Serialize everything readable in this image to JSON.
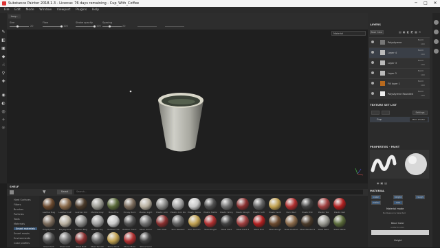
{
  "window": {
    "title": "Substance Painter 2018.1.3 - License: 76 days remaining - Cup_With_Coffee",
    "minimize": "─",
    "maximize": "□",
    "close": "✕"
  },
  "menu": [
    "File",
    "Edit",
    "Mode",
    "Window",
    "Viewport",
    "Plugins",
    "Help"
  ],
  "tool_options": {
    "preset_button": "Lazy...",
    "sliders": [
      {
        "label": "Size",
        "value": "20"
      },
      {
        "label": "Flow",
        "value": "100"
      },
      {
        "label": "Stroke opacity",
        "value": "100"
      },
      {
        "label": "Spacing",
        "value": "20"
      }
    ]
  },
  "viewport": {
    "mode": "Material"
  },
  "layers": {
    "title": "LAYERS",
    "channel": "Base Color",
    "items": [
      {
        "name": "Polystyrene",
        "blend": "Norm",
        "opacity": "100"
      },
      {
        "name": "Layer 4",
        "blend": "Norm",
        "opacity": "100"
      },
      {
        "name": "Layer 3",
        "blend": "Norm",
        "opacity": "100"
      },
      {
        "name": "Layer 2",
        "blend": "Norm",
        "opacity": "100"
      },
      {
        "name": "Fill layer 1",
        "blend": "Norm",
        "opacity": "100"
      },
      {
        "name": "Polystyrene Rounded",
        "blend": "Norm",
        "opacity": "100"
      }
    ]
  },
  "texture_set_list": {
    "title": "TEXTURE SET LIST",
    "settings_button": "Settings",
    "item": "Cup",
    "shader": "Main shader"
  },
  "properties": {
    "title": "PROPERTIES - PAINT",
    "material_title": "MATERIAL",
    "channels": [
      "color",
      "height",
      "rough",
      "metal",
      "nrm"
    ],
    "material_mode": "Material mode",
    "no_resource": "No Resource Selected",
    "base_color": "Base Color",
    "uniform": "uniform color",
    "height": "Height"
  },
  "shelf": {
    "title": "SHELF",
    "filter": "Smart",
    "search_placeholder": "Search...",
    "categories": [
      "Hard Surfaces",
      "Filters",
      "Brushes",
      "Particles",
      "Tools",
      "Materials",
      "Smart materials",
      "Smart masks",
      "Environments",
      "Color profiles"
    ],
    "row1": [
      "Leather Bag",
      "Leather Calf",
      "Leather Old",
      "Marble Gray",
      "Moss Fine",
      "Honey Rock",
      "Plaster Light",
      "Plastic Arm",
      "Plastic Arm Rough",
      "Plastic Gloss",
      "Plastic Matte",
      "Plastic Shiny",
      "Plastic Rough",
      "Plastic Soft",
      "Plastic Gold",
      "Paint Red",
      "Plastic Ext",
      "Plastic Tex",
      "Plastic Red"
    ],
    "row2": [
      "Polystyrene",
      "Polystyrene",
      "Protein Bag",
      "Rubber Dry",
      "Rubber Tire",
      "Rubber Tire 2",
      "Silver Armor",
      "Skin Pale",
      "Skin Peasant",
      "Skin Human",
      "Steel Bright",
      "Steel Dark",
      "Steel Dark 2",
      "Steel Dull",
      "Steel Rough",
      "Steel Painted",
      "Steel Painted 2",
      "Steel Paint",
      "Steel Matte"
    ],
    "row3": [
      "Steel Dark",
      "Steel Gold",
      "Steel Rust",
      "Steel Tarnish",
      "Stone Rock",
      "Stone Moss",
      "Stone Sand"
    ]
  },
  "colors": {
    "accent": "#e0a030",
    "selected": "#3d5a7a",
    "smart": "#1e1e1e"
  }
}
